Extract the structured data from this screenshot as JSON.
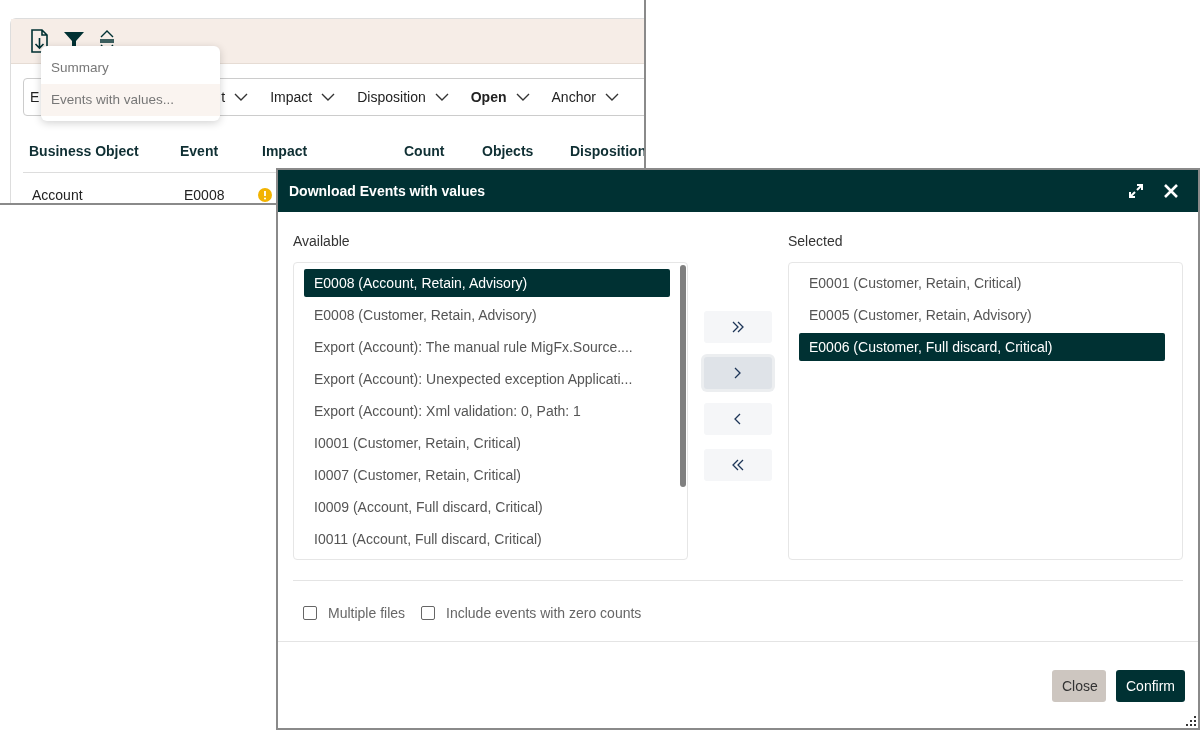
{
  "background_window": {
    "toolbar": [
      {
        "kind": "download"
      },
      {
        "kind": "filter"
      },
      {
        "kind": "collapse"
      }
    ],
    "menu": [
      {
        "label": "Summary",
        "selected": false
      },
      {
        "label": "Events with values...",
        "selected": true
      }
    ],
    "filters": [
      {
        "label": "E",
        "bold": false
      },
      {
        "label": "t",
        "bold": false
      },
      {
        "label": "Impact",
        "bold": false
      },
      {
        "label": "Disposition",
        "bold": false
      },
      {
        "label": "Open",
        "bold": true
      },
      {
        "label": "Anchor",
        "bold": false
      }
    ],
    "table": {
      "columns": [
        "Business Object",
        "Event",
        "Impact",
        "Count",
        "Objects",
        "Disposition"
      ],
      "rows": [
        {
          "business_object": "Account",
          "event": "E0008",
          "impact": {
            "kind": "warning"
          }
        }
      ]
    }
  },
  "dialog": {
    "title": "Download Events with values",
    "available": {
      "label": "Available",
      "items": [
        {
          "text": "E0008 (Account, Retain, Advisory)",
          "selected": true
        },
        {
          "text": "E0008 (Customer, Retain, Advisory)",
          "selected": false
        },
        {
          "text": "Export (Account): The manual rule MigFx.Source....",
          "selected": false
        },
        {
          "text": "Export (Account): Unexpected exception Applicati...",
          "selected": false
        },
        {
          "text": "Export (Account): Xml validation: 0, Path: 1",
          "selected": false
        },
        {
          "text": "I0001 (Customer, Retain, Critical)",
          "selected": false
        },
        {
          "text": "I0007 (Customer, Retain, Critical)",
          "selected": false
        },
        {
          "text": "I0009 (Account, Full discard, Critical)",
          "selected": false
        },
        {
          "text": "I0011 (Account, Full discard, Critical)",
          "selected": false
        }
      ]
    },
    "transfer_buttons": [
      {
        "kind": "all-right",
        "focused": false
      },
      {
        "kind": "right",
        "focused": true
      },
      {
        "kind": "left",
        "focused": false
      },
      {
        "kind": "all-left",
        "focused": false
      }
    ],
    "selected": {
      "label": "Selected",
      "items": [
        {
          "text": "E0001 (Customer, Retain, Critical)",
          "selected": false
        },
        {
          "text": "E0005 (Customer, Retain, Advisory)",
          "selected": false
        },
        {
          "text": "E0006 (Customer, Full discard, Critical)",
          "selected": true
        }
      ]
    },
    "options": [
      {
        "label": "Multiple files",
        "checked": false
      },
      {
        "label": "Include events with zero counts",
        "checked": false
      }
    ],
    "buttons": [
      {
        "label": "Close",
        "kind": "secondary"
      },
      {
        "label": "Confirm",
        "kind": "primary"
      }
    ]
  }
}
